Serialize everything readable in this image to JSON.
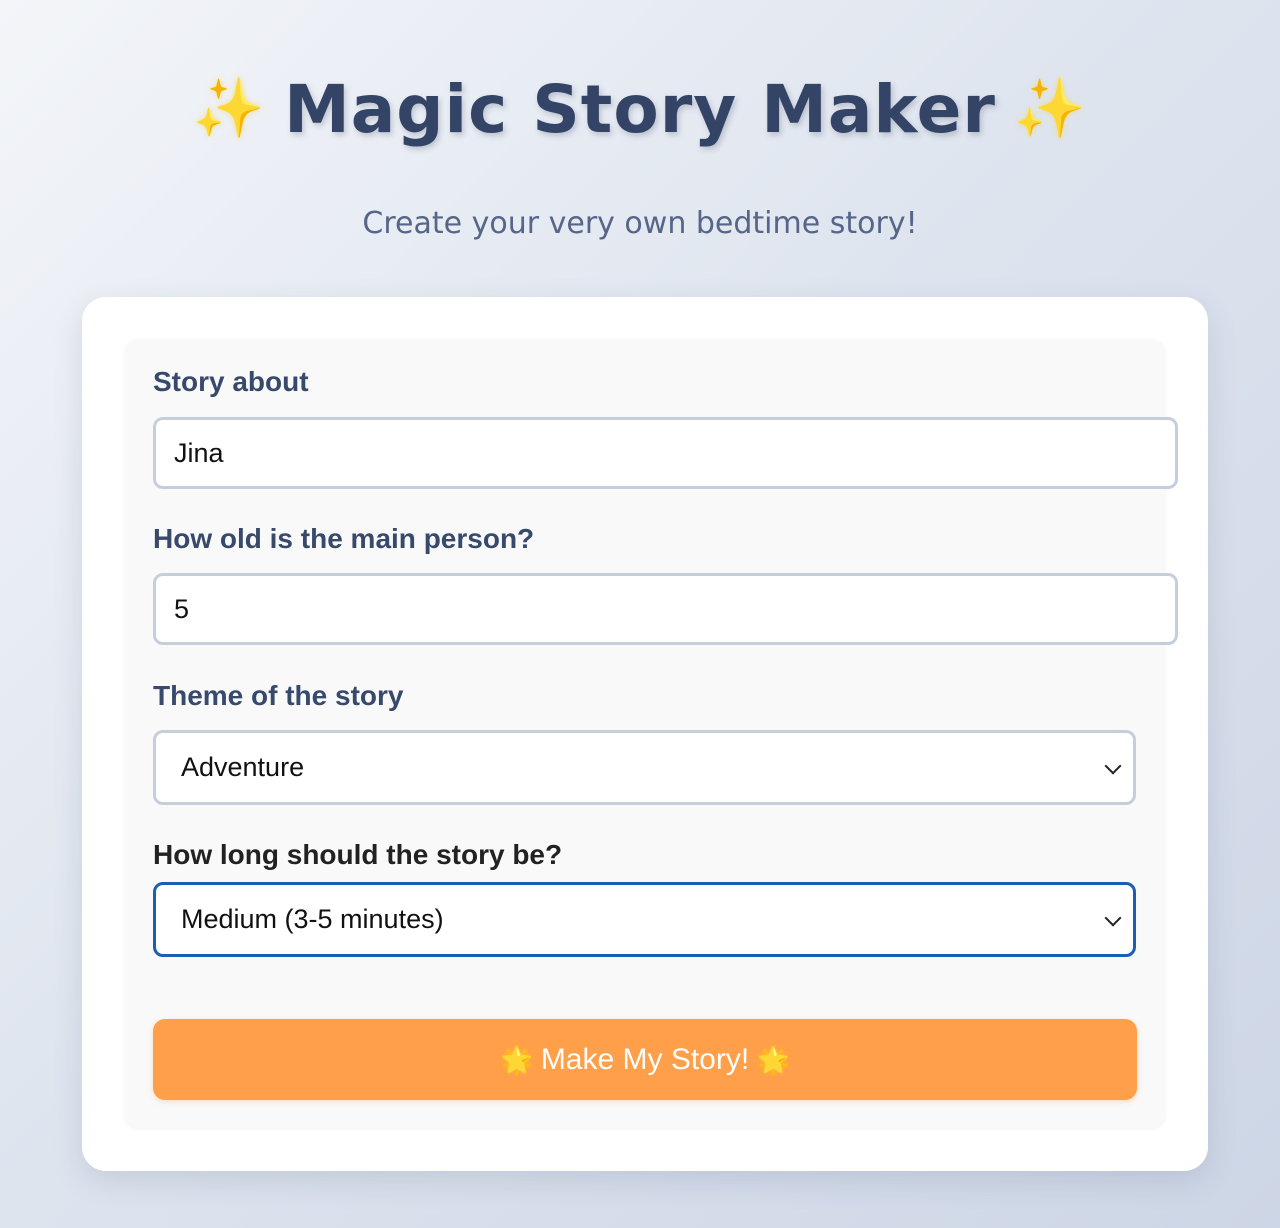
{
  "header": {
    "title": "Magic Story Maker",
    "sparkle_left": "✨",
    "sparkle_right": "✨",
    "subtitle": "Create your very own bedtime story!"
  },
  "form": {
    "story_about": {
      "label": "Story about",
      "value": "Jina"
    },
    "age": {
      "label": "How old is the main person?",
      "value": "5"
    },
    "theme": {
      "label": "Theme of the story",
      "selected": "Adventure"
    },
    "length": {
      "label": "How long should the story be?",
      "selected": "Medium (3-5 minutes)"
    },
    "submit": {
      "label": "Make My Story!",
      "star_left": "🌟",
      "star_right": "🌟"
    }
  },
  "colors": {
    "title": "#334466",
    "subtitle": "#556688",
    "button": "#ff9f4a",
    "focus_border": "#1a5fb4",
    "field_border": "#c4cedd"
  }
}
